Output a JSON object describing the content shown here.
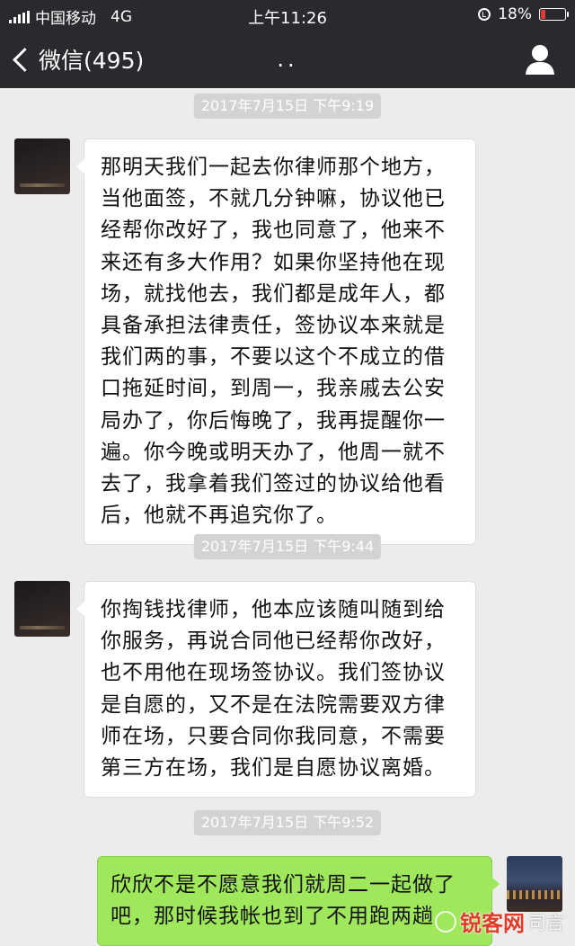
{
  "status_bar": {
    "carrier": "中国移动",
    "network": "4G",
    "time": "上午11:26",
    "battery_text": "18%",
    "battery_level": 0.18
  },
  "nav": {
    "back_label": "微信(495)",
    "title": ".."
  },
  "messages": [
    {
      "timestamp": "2017年7月15日 下午9:19",
      "direction": "received",
      "lines": [
        "那明天我们一起去你律师那个地方，",
        "当他面签，不就几分钟嘛，协议他已",
        "经帮你改好了，我也同意了，他来不",
        "来还有多大作用？如果你坚持他在现",
        "场，就找他去，我们都是成年人，都",
        "具备承担法律责任，签协议本来就是",
        "我们两的事，不要以这个不成立的借",
        "口拖延时间，到周一，我亲戚去公安",
        "局办了，你后悔晚了，我再提醒你一",
        "遍。你今晚或明天办了，他周一就不",
        "去了，我拿着我们签过的协议给他看",
        "后，他就不再追究你了。"
      ]
    },
    {
      "timestamp": "2017年7月15日 下午9:44",
      "direction": "received",
      "lines": [
        "你掏钱找律师，他本应该随叫随到给",
        "你服务，再说合同他已经帮你改好，",
        "也不用他在现场签协议。我们签协议",
        "是自愿的，又不是在法院需要双方律",
        "师在场，只要合同你我同意，不需要",
        "第三方在场，我们是自愿协议离婚。"
      ]
    },
    {
      "timestamp": "2017年7月15日 下午9:52",
      "direction": "sent",
      "lines": [
        "欣欣不是不愿意我们就周二一起做了",
        "吧，那时候我帐也到了不用跑两趟"
      ]
    }
  ],
  "watermark": {
    "brand": "锐客网",
    "rest": "司言"
  },
  "colors": {
    "header_bg": "#2a2a2e",
    "chat_bg": "#ececec",
    "sent_bubble": "#9fe75b",
    "received_bubble": "#ffffff",
    "battery_low": "#e53935"
  }
}
